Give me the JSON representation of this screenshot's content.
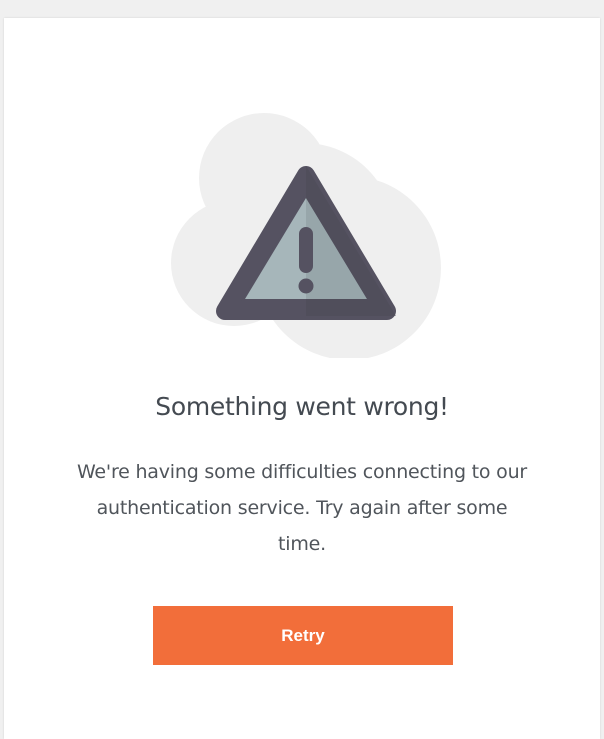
{
  "error": {
    "icon": "warning-triangle-icon",
    "title": "Something went wrong!",
    "message": "We're having some difficulties connecting to our authentication service. Try again after some time."
  },
  "actions": {
    "retry_label": "Retry"
  },
  "colors": {
    "accent": "#f26e3a",
    "cloud": "#efefef",
    "triangle_outline": "#555261",
    "triangle_fill": "#a3b3b7",
    "text": "#444a51"
  }
}
